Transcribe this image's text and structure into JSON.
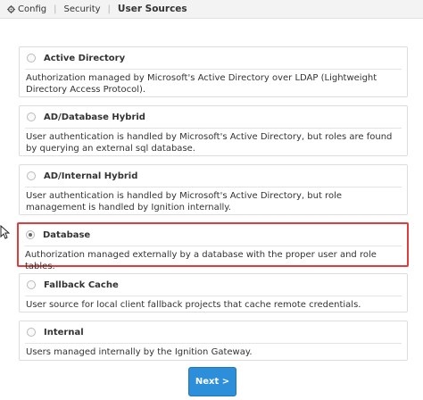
{
  "breadcrumb": {
    "items": [
      "Config",
      "Security",
      "User Sources"
    ]
  },
  "options": [
    {
      "title": "Active Directory",
      "desc": "Authorization managed by Microsoft's Active Directory over LDAP (Lightweight Directory Access Protocol).",
      "selected": false
    },
    {
      "title": "AD/Database Hybrid",
      "desc": "User authentication is handled by Microsoft's Active Directory, but roles are found by querying an external sql database.",
      "selected": false
    },
    {
      "title": "AD/Internal Hybrid",
      "desc": "User authentication is handled by Microsoft's Active Directory, but role management is handled by Ignition internally.",
      "selected": false
    },
    {
      "title": "Database",
      "desc": "Authorization managed externally by a database with the proper user and role tables.",
      "selected": true
    },
    {
      "title": "Fallback Cache",
      "desc": "User source for local client fallback projects that cache remote credentials.",
      "selected": false
    },
    {
      "title": "Internal",
      "desc": "Users managed internally by the Ignition Gateway.",
      "selected": false
    }
  ],
  "next_label": "Next >",
  "colors": {
    "accent": "#2d8fd9",
    "highlight": "#e23b3b"
  },
  "icons": [
    "gear-icon",
    "cursor-icon"
  ]
}
